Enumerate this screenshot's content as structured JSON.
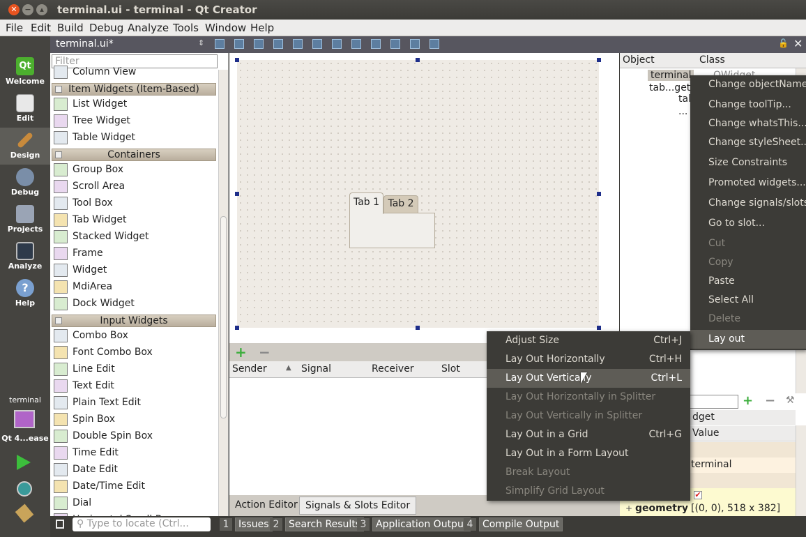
{
  "window": {
    "title": "terminal.ui - terminal - Qt Creator"
  },
  "menubar": {
    "items": [
      "File",
      "Edit",
      "Build",
      "Debug",
      "Analyze",
      "Tools",
      "Window",
      "Help"
    ]
  },
  "modes": [
    {
      "label": "Welcome",
      "icon": "qt-logo-icon",
      "color": "#4caf2e"
    },
    {
      "label": "Edit",
      "icon": "document-icon",
      "color": "#e8e8e8"
    },
    {
      "label": "Design",
      "icon": "brush-icon",
      "color": "#c88a3c"
    },
    {
      "label": "Debug",
      "icon": "bug-icon",
      "color": "#7a8ea8"
    },
    {
      "label": "Projects",
      "icon": "folder-icon",
      "color": "#9aa4b5"
    },
    {
      "label": "Analyze",
      "icon": "monitor-icon",
      "color": "#2e3a4a"
    },
    {
      "label": "Help",
      "icon": "question-icon",
      "color": "#7aa0d0"
    }
  ],
  "session": {
    "project": "terminal",
    "kit": "Qt 4...ease"
  },
  "toolbar": {
    "document": "terminal.ui*"
  },
  "widgetbox": {
    "filter_placeholder": "Filter",
    "rows": [
      {
        "kind": "item",
        "label": "Column View"
      },
      {
        "kind": "cat",
        "label": "Item Widgets (Item-Based)"
      },
      {
        "kind": "item",
        "label": "List Widget"
      },
      {
        "kind": "item",
        "label": "Tree Widget"
      },
      {
        "kind": "item",
        "label": "Table Widget"
      },
      {
        "kind": "cat",
        "label": "Containers"
      },
      {
        "kind": "item",
        "label": "Group Box"
      },
      {
        "kind": "item",
        "label": "Scroll Area"
      },
      {
        "kind": "item",
        "label": "Tool Box"
      },
      {
        "kind": "item",
        "label": "Tab Widget"
      },
      {
        "kind": "item",
        "label": "Stacked Widget"
      },
      {
        "kind": "item",
        "label": "Frame"
      },
      {
        "kind": "item",
        "label": "Widget"
      },
      {
        "kind": "item",
        "label": "MdiArea"
      },
      {
        "kind": "item",
        "label": "Dock Widget"
      },
      {
        "kind": "cat",
        "label": "Input Widgets"
      },
      {
        "kind": "item",
        "label": "Combo Box"
      },
      {
        "kind": "item",
        "label": "Font Combo Box"
      },
      {
        "kind": "item",
        "label": "Line Edit"
      },
      {
        "kind": "item",
        "label": "Text Edit"
      },
      {
        "kind": "item",
        "label": "Plain Text Edit"
      },
      {
        "kind": "item",
        "label": "Spin Box"
      },
      {
        "kind": "item",
        "label": "Double Spin Box"
      },
      {
        "kind": "item",
        "label": "Time Edit"
      },
      {
        "kind": "item",
        "label": "Date Edit"
      },
      {
        "kind": "item",
        "label": "Date/Time Edit"
      },
      {
        "kind": "item",
        "label": "Dial"
      },
      {
        "kind": "item",
        "label": "Horizontal Scroll Bar"
      }
    ]
  },
  "form": {
    "tabs": [
      "Tab 1",
      "Tab 2"
    ]
  },
  "signals": {
    "columns": [
      "Sender",
      "Signal",
      "Receiver",
      "Slot"
    ]
  },
  "editor_tabs": [
    "Action Editor",
    "Signals & Slots Editor"
  ],
  "status": {
    "locate_placeholder": "Type to locate (Ctrl...",
    "outputs": [
      {
        "num": "1",
        "label": "Issues"
      },
      {
        "num": "2",
        "label": "Search Results"
      },
      {
        "num": "3",
        "label": "Application Output"
      },
      {
        "num": "4",
        "label": "Compile Output"
      }
    ]
  },
  "object_inspector": {
    "columns": [
      "Object",
      "Class"
    ],
    "rows": [
      {
        "name": "terminal",
        "class": "QWidget"
      },
      {
        "name": "tab...get",
        "class": ""
      },
      {
        "name": "tal",
        "class": ""
      },
      {
        "name": "...",
        "class": ""
      }
    ]
  },
  "property_editor": {
    "title": "dget",
    "value_header": "Value",
    "object_name_value": "terminal",
    "geometry_label": "geometry",
    "geometry_value": "[(0, 0), 518 x 382]"
  },
  "context_menu": {
    "items": [
      {
        "label": "Change objectName...",
        "enabled": true
      },
      {
        "label": "Change toolTip...",
        "enabled": true
      },
      {
        "label": "Change whatsThis...",
        "enabled": true
      },
      {
        "label": "Change styleSheet...",
        "enabled": true
      },
      {
        "label": "Size Constraints",
        "enabled": true
      },
      {
        "label": "Promoted widgets...",
        "enabled": true
      },
      {
        "label": "Change signals/slots...",
        "enabled": true
      },
      {
        "label": "Go to slot...",
        "enabled": true
      },
      {
        "label": "Cut",
        "enabled": false
      },
      {
        "label": "Copy",
        "enabled": false
      },
      {
        "label": "Paste",
        "enabled": true
      },
      {
        "label": "Select All",
        "enabled": true
      },
      {
        "label": "Delete",
        "enabled": false
      },
      {
        "label": "Lay out",
        "enabled": true,
        "highlighted": true
      }
    ]
  },
  "layout_submenu": {
    "items": [
      {
        "label": "Adjust Size",
        "shortcut": "Ctrl+J",
        "enabled": true
      },
      {
        "label": "Lay Out Horizontally",
        "shortcut": "Ctrl+H",
        "enabled": true
      },
      {
        "label": "Lay Out Vertically",
        "shortcut": "Ctrl+L",
        "enabled": true,
        "highlighted": true
      },
      {
        "label": "Lay Out Horizontally in Splitter",
        "shortcut": "",
        "enabled": false
      },
      {
        "label": "Lay Out Vertically in Splitter",
        "shortcut": "",
        "enabled": false
      },
      {
        "label": "Lay Out in a Grid",
        "shortcut": "Ctrl+G",
        "enabled": true
      },
      {
        "label": "Lay Out in a Form Layout",
        "shortcut": "",
        "enabled": true
      },
      {
        "label": "Break Layout",
        "shortcut": "",
        "enabled": false
      },
      {
        "label": "Simplify Grid Layout",
        "shortcut": "",
        "enabled": false
      }
    ]
  }
}
